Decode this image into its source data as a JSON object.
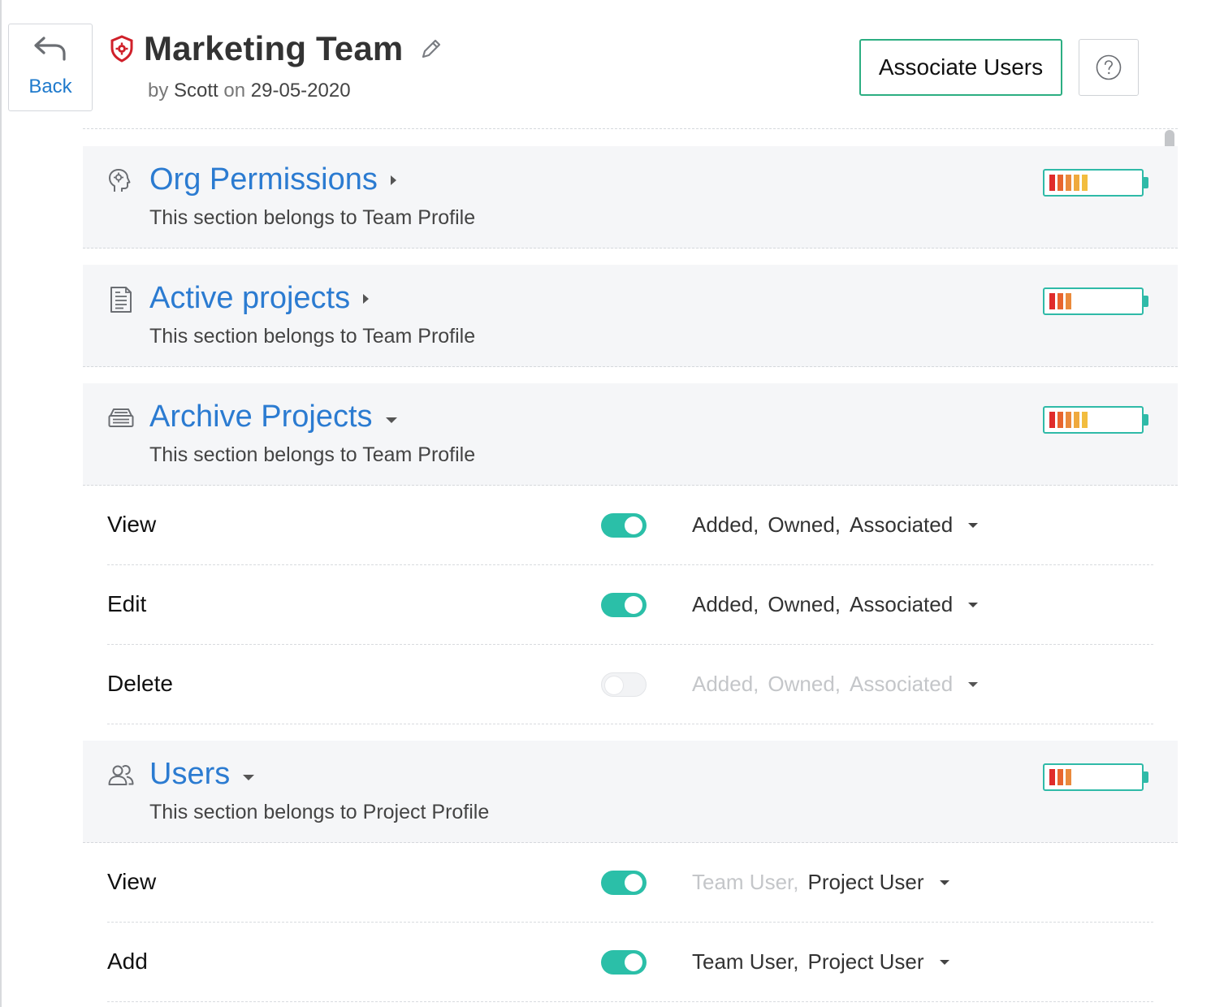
{
  "back": {
    "label": "Back"
  },
  "header": {
    "title": "Marketing Team",
    "by_prefix": "by",
    "author": "Scott",
    "on_prefix": "on",
    "date": "29-05-2020"
  },
  "actions": {
    "associate_users": "Associate Users"
  },
  "colors": {
    "accent": "#2b7bd1",
    "toggle_on": "#2bbfa8",
    "battery_border": "#2fbaa8",
    "bar_red": "#e02b2b",
    "bar_orange": "#ea8a3c",
    "bar_yellow": "#f2bd3f"
  },
  "sections": [
    {
      "title": "Org Permissions",
      "subtitle": "This section belongs to Team Profile",
      "icon": "org-permissions-icon",
      "expanded": false,
      "level_bars": 5
    },
    {
      "title": "Active projects",
      "subtitle": "This section belongs to Team Profile",
      "icon": "document-icon",
      "expanded": false,
      "level_bars": 3
    },
    {
      "title": "Archive Projects",
      "subtitle": "This section belongs to Team Profile",
      "icon": "archive-icon",
      "expanded": true,
      "level_bars": 5,
      "rows": [
        {
          "label": "View",
          "enabled": true,
          "values": [
            {
              "text": "Added,",
              "active": true
            },
            {
              "text": "Owned,",
              "active": true
            },
            {
              "text": "Associated",
              "active": true
            }
          ]
        },
        {
          "label": "Edit",
          "enabled": true,
          "values": [
            {
              "text": "Added,",
              "active": true
            },
            {
              "text": "Owned,",
              "active": true
            },
            {
              "text": "Associated",
              "active": true
            }
          ]
        },
        {
          "label": "Delete",
          "enabled": false,
          "values": [
            {
              "text": "Added,",
              "active": false
            },
            {
              "text": "Owned,",
              "active": false
            },
            {
              "text": "Associated",
              "active": false
            }
          ]
        }
      ]
    },
    {
      "title": "Users",
      "subtitle": "This section belongs to Project Profile",
      "icon": "users-icon",
      "expanded": true,
      "level_bars": 3,
      "rows": [
        {
          "label": "View",
          "enabled": true,
          "values": [
            {
              "text": "Team User,",
              "active": false
            },
            {
              "text": "Project User",
              "active": true
            }
          ]
        },
        {
          "label": "Add",
          "enabled": true,
          "values": [
            {
              "text": "Team User,",
              "active": true
            },
            {
              "text": "Project User",
              "active": true
            }
          ]
        }
      ]
    }
  ]
}
